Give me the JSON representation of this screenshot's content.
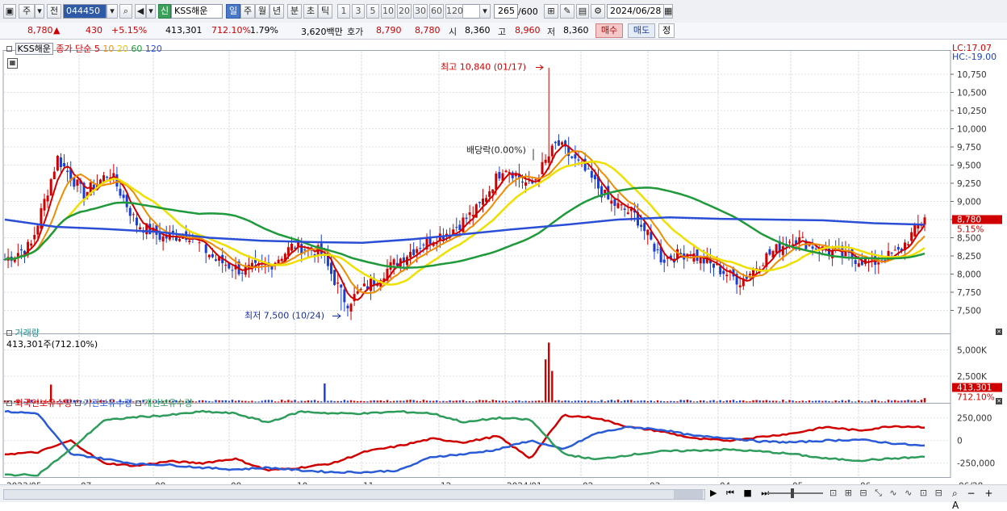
{
  "toolbar": {
    "stock_code": "044450",
    "period_type": "주",
    "prev_label": "전",
    "sin_badge": "신",
    "stock_name": "KSS해운",
    "tabs": [
      "일",
      "주",
      "월",
      "년",
      "분",
      "초",
      "틱"
    ],
    "active_tab": "일",
    "intervals": [
      "1",
      "3",
      "5",
      "10",
      "20",
      "30",
      "60",
      "120"
    ],
    "count_value": "265",
    "count_max": "/600",
    "date": "2024/06/28"
  },
  "quote": {
    "price": "8,780",
    "arrow": "▲",
    "change": "430",
    "change_pct": "+5.15%",
    "volume": "413,301",
    "volume_ratio": "712.10%",
    "turnover": "1.79%",
    "amount": "3,620백만",
    "hoga_label": "호가",
    "ask": "8,790",
    "bid": "8,780",
    "open_label": "시",
    "open": "8,360",
    "high_label": "고",
    "high": "8,960",
    "low_label": "저",
    "low": "8,360",
    "buy_label": "매수",
    "sell_label": "매도",
    "correct_label": "정"
  },
  "price_pane": {
    "stock_name": "KSS해운",
    "ma_label": "종가 단순",
    "ma_periods": [
      "5",
      "10",
      "20",
      "60",
      "120"
    ],
    "lc": "LC:17.07",
    "hc": "HC:-19.00",
    "current_tag": "8,780",
    "current_pct_tag": "5.15%",
    "annot_high": "최고 10,840 (01/17)",
    "annot_low": "최저 7,500 (10/24)",
    "annot_dividend": "배당락(0.00%)",
    "y_ticks": [
      "10,750",
      "10,500",
      "10,250",
      "10,000",
      "9,750",
      "9,500",
      "9,250",
      "9,000",
      "8,750",
      "8,500",
      "8,250",
      "8,000",
      "7,750",
      "7,500"
    ]
  },
  "volume_pane": {
    "title": "거래량",
    "value_text": "413,301주(712.10%)",
    "y_ticks": [
      "5,000K",
      "2,500K"
    ],
    "current_tag": "413,301",
    "current_pct_tag": "712.10%"
  },
  "holdings_pane": {
    "legend": [
      "외국인보유수량",
      "기관보유수량",
      "개인보유수량"
    ],
    "y_ticks": [
      "250,000",
      "0",
      "-250,000"
    ]
  },
  "x_axis": [
    "2023/05",
    "07",
    "08",
    "09",
    "10",
    "11",
    "12",
    "2024/01",
    "02",
    "03",
    "04",
    "05",
    "06",
    "06/28"
  ],
  "colors": {
    "up": "#d00000",
    "down": "#1a3fd0",
    "ma5": "#d00000",
    "ma10": "#f08c00",
    "ma20": "#f0e000",
    "ma60": "#1e9a3a",
    "ma120": "#2a4fd6",
    "foreign": "#d00000",
    "institution": "#2a5bd6",
    "individual": "#2e9c5a"
  },
  "chart_data": {
    "type": "candlestick",
    "x_range": [
      "2023/05",
      "2024/06/28"
    ],
    "price_ylim": [
      7400,
      10900
    ],
    "annotations": [
      {
        "label": "최고",
        "value": 10840,
        "date": "01/17"
      },
      {
        "label": "최저",
        "value": 7500,
        "date": "10/24"
      }
    ],
    "close_path_approx": [
      8200,
      8400,
      9600,
      9100,
      9400,
      8700,
      8500,
      8550,
      8200,
      8050,
      8100,
      8400,
      8300,
      7600,
      7900,
      8200,
      8450,
      8600,
      8900,
      9500,
      9200,
      9800,
      9450,
      9000,
      8800,
      8200,
      8300,
      8100,
      7900,
      8250,
      8500,
      8350,
      8250,
      8150,
      8300,
      8780
    ],
    "ma120_path_approx": [
      8750,
      8650,
      8620,
      8580,
      8500,
      8460,
      8440,
      8430,
      8480,
      8550,
      8620,
      8680,
      8750,
      8780,
      8760,
      8750,
      8740,
      8700,
      8680
    ],
    "volume_peak_k": 5700,
    "holdings_ylim": [
      -400000,
      350000
    ]
  }
}
